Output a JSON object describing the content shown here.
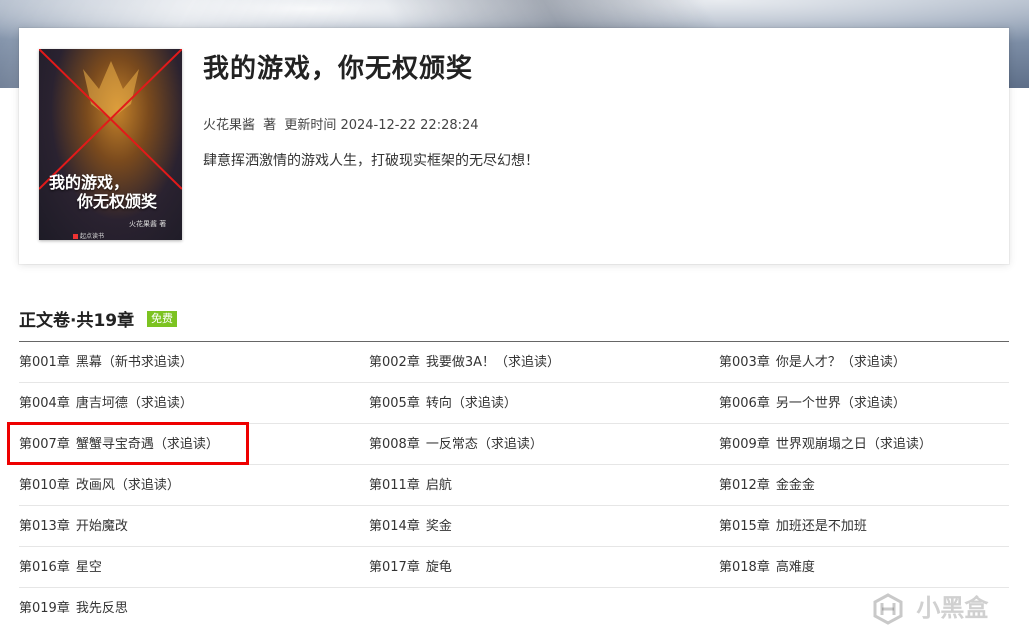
{
  "book": {
    "title": "我的游戏，你无权颁奖",
    "author": "火花果酱",
    "author_suffix": "著",
    "update_label": "更新时间",
    "update_time": "2024-12-22 22:28:24",
    "intro": "肆意挥洒激情的游戏人生，打破现实框架的无尽幻想！",
    "cover": {
      "title_line1": "我的游戏，",
      "title_line2": "你无权颁奖",
      "author": "火花果酱 著",
      "publisher": "起点读书"
    }
  },
  "volume": {
    "title": "正文卷·共19章",
    "badge": "免费"
  },
  "chapters": [
    {
      "num": "第001章",
      "title": "黑幕（新书求追读）"
    },
    {
      "num": "第002章",
      "title": "我要做3A！（求追读）"
    },
    {
      "num": "第003章",
      "title": "你是人才？（求追读）"
    },
    {
      "num": "第004章",
      "title": "唐吉坷德（求追读）"
    },
    {
      "num": "第005章",
      "title": "转向（求追读）"
    },
    {
      "num": "第006章",
      "title": "另一个世界（求追读）"
    },
    {
      "num": "第007章",
      "title": "蟹蟹寻宝奇遇（求追读）"
    },
    {
      "num": "第008章",
      "title": "一反常态（求追读）"
    },
    {
      "num": "第009章",
      "title": "世界观崩塌之日（求追读）"
    },
    {
      "num": "第010章",
      "title": "改画风（求追读）"
    },
    {
      "num": "第011章",
      "title": "启航"
    },
    {
      "num": "第012章",
      "title": "金金金"
    },
    {
      "num": "第013章",
      "title": "开始魔改"
    },
    {
      "num": "第014章",
      "title": "奖金"
    },
    {
      "num": "第015章",
      "title": "加班还是不加班"
    },
    {
      "num": "第016章",
      "title": "星空"
    },
    {
      "num": "第017章",
      "title": "旋龟"
    },
    {
      "num": "第018章",
      "title": "高难度"
    },
    {
      "num": "第019章",
      "title": "我先反思"
    }
  ],
  "watermark": "小黑盒",
  "colors": {
    "badge": "#7cc321",
    "highlight": "#e00000"
  }
}
